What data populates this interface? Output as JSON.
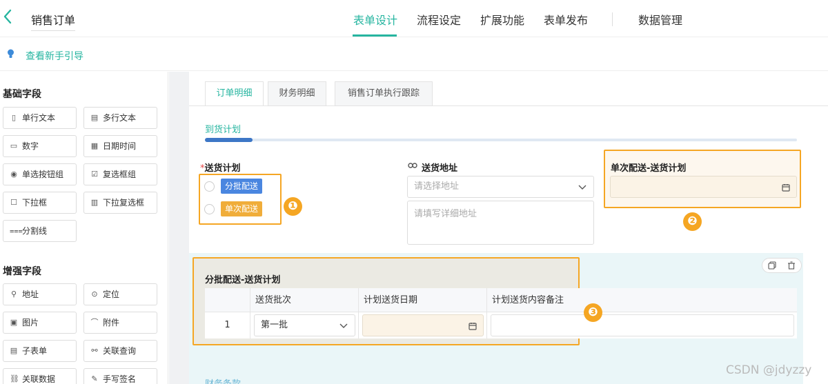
{
  "header": {
    "back_icon": "chevron-left-icon",
    "title": "销售订单",
    "tabs": [
      "表单设计",
      "流程设定",
      "扩展功能",
      "表单发布",
      "数据管理"
    ],
    "active_tab": "表单设计",
    "accent_color": "#26b5a0"
  },
  "guide": {
    "icon": "lightbulb-icon",
    "text": "查看新手引导"
  },
  "sidebar": {
    "basic_title": "基础字段",
    "basic_fields": [
      {
        "label": "单行文本",
        "icon": "text-line-icon"
      },
      {
        "label": "多行文本",
        "icon": "text-multiline-icon"
      },
      {
        "label": "数字",
        "icon": "number-icon"
      },
      {
        "label": "日期时间",
        "icon": "calendar-icon"
      },
      {
        "label": "单选按钮组",
        "icon": "radio-icon"
      },
      {
        "label": "复选框组",
        "icon": "checkbox-icon"
      },
      {
        "label": "下拉框",
        "icon": "dropdown-icon"
      },
      {
        "label": "下拉复选框",
        "icon": "dropdown-multi-icon"
      },
      {
        "label": "分割线",
        "icon": "divider-icon"
      }
    ],
    "advanced_title": "增强字段",
    "advanced_fields": [
      {
        "label": "地址",
        "icon": "map-pin-icon"
      },
      {
        "label": "定位",
        "icon": "locate-icon"
      },
      {
        "label": "图片",
        "icon": "image-icon"
      },
      {
        "label": "附件",
        "icon": "attachment-icon"
      },
      {
        "label": "子表单",
        "icon": "subform-icon"
      },
      {
        "label": "关联查询",
        "icon": "link-query-icon"
      },
      {
        "label": "关联数据",
        "icon": "link-data-icon"
      },
      {
        "label": "手写签名",
        "icon": "signature-icon"
      }
    ]
  },
  "form": {
    "sub_tabs": [
      "订单明细",
      "财务明细",
      "销售订单执行跟踪"
    ],
    "active_sub_tab": "订单明细",
    "group_title": "到货计划",
    "progress": 0.08,
    "delivery_plan": {
      "required_mark": "*",
      "label": "送货计划",
      "options": [
        {
          "label": "分批配送",
          "color": "#4a86e0"
        },
        {
          "label": "单次配送",
          "color": "#f0ad3a"
        }
      ]
    },
    "address": {
      "label": "送货地址",
      "select_placeholder": "请选择地址",
      "detail_placeholder": "请填写详细地址"
    },
    "single_plan": {
      "label": "单次配送-送货计划"
    },
    "batch_plan": {
      "label": "分批配送-送货计划",
      "columns": [
        "",
        "送货批次",
        "计划送货日期",
        "计划送货内容备注"
      ],
      "rows": [
        {
          "index": "1",
          "batch": "第一批",
          "date": "",
          "note": ""
        }
      ]
    },
    "next_section": "财务条款"
  },
  "badges": [
    "❶",
    "❷",
    "❸"
  ],
  "highlight_color": "#f5a623",
  "watermark": "CSDN @jdyzzy"
}
